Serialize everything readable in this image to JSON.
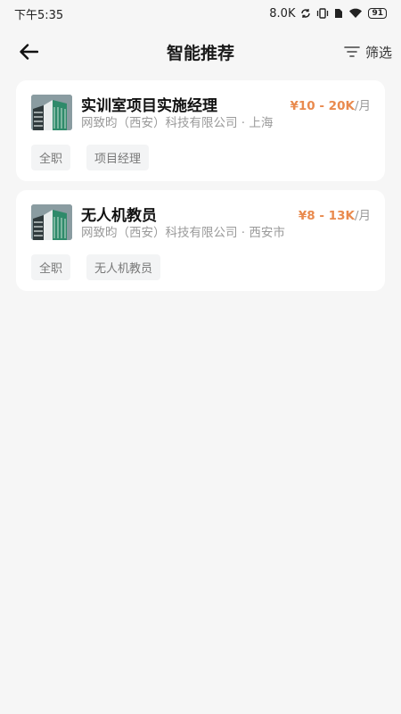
{
  "status_bar": {
    "time": "下午5:35",
    "network_speed": "8.0K",
    "battery_level": "91"
  },
  "nav": {
    "title": "智能推荐",
    "filter_label": "筛选"
  },
  "jobs": [
    {
      "title": "实训室项目实施经理",
      "company": "网致昀（西安）科技有限公司",
      "separator": "·",
      "location": "上海",
      "salary": "¥10 - 20K",
      "salary_unit": "/月",
      "tags": [
        "全职",
        "项目经理"
      ]
    },
    {
      "title": "无人机教员",
      "company": "网致昀（西安）科技有限公司",
      "separator": "·",
      "location": "西安市",
      "salary": "¥8 - 13K",
      "salary_unit": "/月",
      "tags": [
        "全职",
        "无人机教员"
      ]
    }
  ],
  "colors": {
    "salary": "#e98a4e",
    "background": "#f6f6f6",
    "card": "#ffffff",
    "tag_bg": "#f3f4f5"
  },
  "icons": {
    "back": "arrow-left-icon",
    "filter": "filter-lines-icon",
    "logo": "building-logo"
  }
}
